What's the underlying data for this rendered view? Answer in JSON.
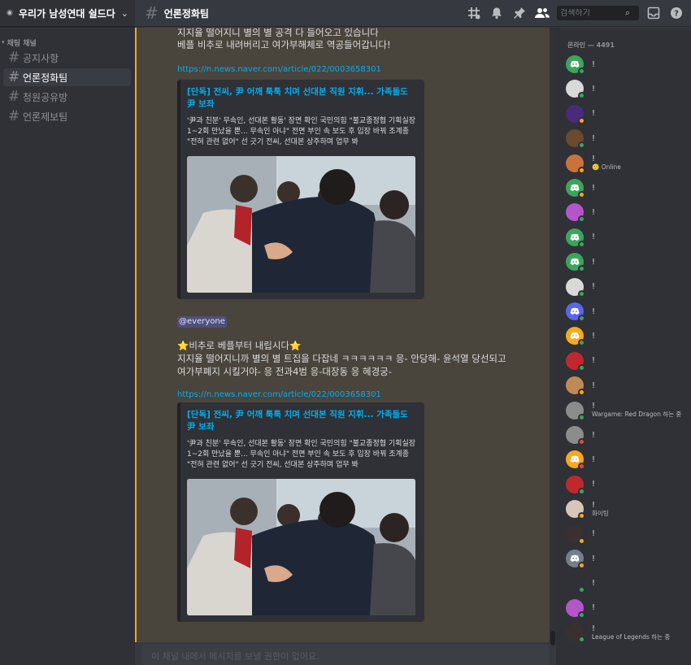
{
  "server": {
    "name": "우리가 남성연대 쉴드다"
  },
  "sidebar": {
    "category": "채팅 채널",
    "channels": [
      {
        "name": "공지사항",
        "active": false
      },
      {
        "name": "언론정화팀",
        "active": true
      },
      {
        "name": "청원공유방",
        "active": false
      },
      {
        "name": "언론제보팀",
        "active": false
      }
    ]
  },
  "header": {
    "channel": "언론정화팀",
    "search_placeholder": "검색하기"
  },
  "messages": {
    "top_line1": "지지율 떨어지니 별의 별 공격 다 들어오고 있습니다",
    "top_line2": "베플 비추로 내려버리고 여가부해체로 역공들어갑니다!",
    "link1": "https://n.news.naver.com/article/022/0003658301",
    "mention": "@everyone",
    "body_line1": "⭐비추로 베플부터 내립시다⭐",
    "body_line2": "지지율 떨어지니까 별의 별 트집을 다잡네 ㅋㅋㅋㅋㅋㅋ 응- 안당해- 윤석열 당선되고",
    "body_line3": "여가부폐지 시킬거야- 응 전과4범 응-대장동 응 혜경궁-",
    "link2": "https://n.news.naver.com/article/022/0003658301"
  },
  "embed": {
    "title": "[단독] 전씨, 尹 어깨 툭툭 치며 선대본 직원 지휘... 가족들도 尹 보좌",
    "description": "'尹과 친분' 무속인, 선대본 활동' 장면 확인 국민의힘 \"불교종정협 기획실장 1~2회 만났을 뿐... 무속인 아냐\" 전면 부인 속 보도 후 입장 바꿔 조계종 \"전혀 관련 없어\" 선 긋기 전씨, 선대본 상주하며 업무 봐"
  },
  "composer": {
    "placeholder": "이 채널 내에서 메시지를 보낼 권한이 없어요."
  },
  "members_panel": {
    "header": "온라인 — 4491",
    "members": [
      {
        "name": "!",
        "activity": "",
        "status": "online",
        "avatar": "discord-green"
      },
      {
        "name": "!",
        "activity": "",
        "status": "online",
        "avatar": "photo-bw"
      },
      {
        "name": "!",
        "activity": "",
        "status": "idle",
        "avatar": "photo-purple"
      },
      {
        "name": "!",
        "activity": "",
        "status": "online",
        "avatar": "photo-brown"
      },
      {
        "name": "!",
        "activity": "🙂 Online",
        "status": "idle",
        "avatar": "photo-orange"
      },
      {
        "name": "!",
        "activity": "",
        "status": "idle",
        "avatar": "discord-green"
      },
      {
        "name": "!",
        "activity": "",
        "status": "online",
        "avatar": "photo-pink"
      },
      {
        "name": "!",
        "activity": "",
        "status": "online",
        "avatar": "discord-green"
      },
      {
        "name": "!",
        "activity": "",
        "status": "online",
        "avatar": "discord-green"
      },
      {
        "name": "!",
        "activity": "",
        "status": "online",
        "avatar": "photo-bw"
      },
      {
        "name": "!",
        "activity": "",
        "status": "online",
        "avatar": "discord-blurple"
      },
      {
        "name": "!",
        "activity": "",
        "status": "online",
        "avatar": "discord-yellow"
      },
      {
        "name": "!",
        "activity": "",
        "status": "online",
        "avatar": "photo-red"
      },
      {
        "name": "!",
        "activity": "",
        "status": "idle",
        "avatar": "photo-food"
      },
      {
        "name": "!",
        "activity": "Wargame: Red Dragon 하는 중",
        "status": "online",
        "avatar": "photo-grey"
      },
      {
        "name": "!",
        "activity": "",
        "status": "dnd",
        "avatar": "photo-grey"
      },
      {
        "name": "!",
        "activity": "",
        "status": "dnd",
        "avatar": "discord-yellow"
      },
      {
        "name": "!",
        "activity": "",
        "status": "online",
        "avatar": "photo-red"
      },
      {
        "name": "!",
        "activity": "화이팅",
        "status": "idle",
        "avatar": "photo-light"
      },
      {
        "name": "!",
        "activity": "",
        "status": "idle",
        "avatar": "photo-dark"
      },
      {
        "name": "!",
        "activity": "",
        "status": "idle",
        "avatar": "discord-grey"
      },
      {
        "name": "!",
        "activity": "",
        "status": "online",
        "avatar": "blank"
      },
      {
        "name": "!",
        "activity": "",
        "status": "online",
        "avatar": "photo-pink"
      },
      {
        "name": "!",
        "activity": "League of Legends 하는 중",
        "status": "online",
        "avatar": "photo-dark"
      }
    ]
  },
  "colors": {
    "accent_blurple": "#5865f2",
    "link": "#00aff4",
    "mention_highlight": "#faa81a",
    "online": "#3ba55c",
    "idle": "#faa81a",
    "dnd": "#ed4245"
  }
}
